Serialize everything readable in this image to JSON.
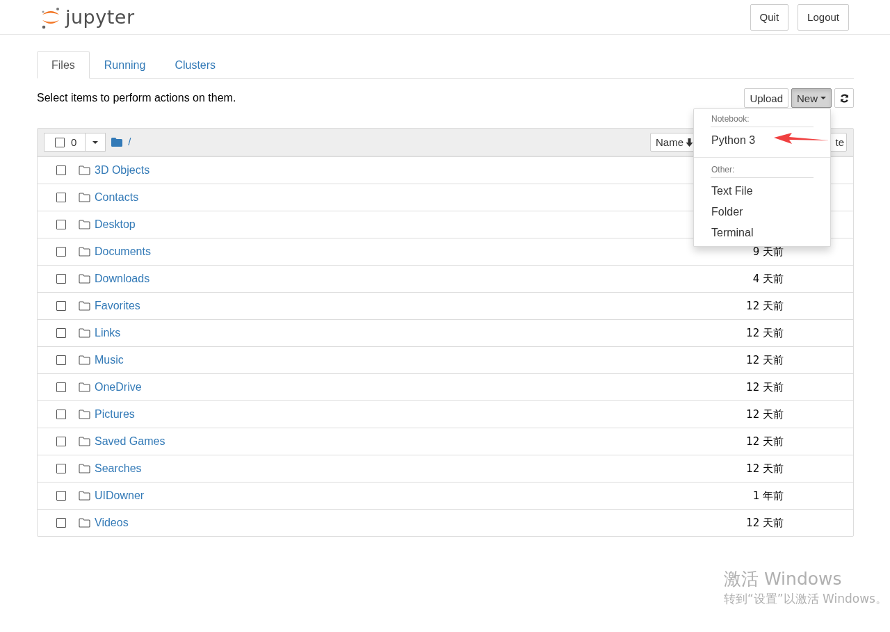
{
  "header": {
    "logo_text": "jupyter",
    "buttons": [
      "Quit",
      "Logout"
    ]
  },
  "tabs": [
    {
      "label": "Files",
      "selected": true
    },
    {
      "label": "Running",
      "selected": false
    },
    {
      "label": "Clusters",
      "selected": false
    }
  ],
  "hint": "Select items to perform actions on them.",
  "toolbar": {
    "upload": "Upload",
    "new": "New",
    "new_open": true
  },
  "list_header": {
    "count": "0",
    "checked": false,
    "path": "/",
    "sort_buttons": [
      "Name",
      "te"
    ]
  },
  "new_menu": {
    "sections": [
      {
        "heading": "Notebook:",
        "items": [
          "Python 3"
        ]
      },
      {
        "heading": "Other:",
        "items": [
          "Text File",
          "Folder",
          "Terminal"
        ]
      }
    ]
  },
  "rows": [
    {
      "name": "3D Objects",
      "checked": false
    },
    {
      "name": "Contacts",
      "checked": false
    },
    {
      "name": "Desktop",
      "checked": false
    },
    {
      "name": "Documents",
      "modified": "9 天前",
      "checked": false
    },
    {
      "name": "Downloads",
      "modified": "4 天前",
      "checked": false
    },
    {
      "name": "Favorites",
      "modified": "12 天前",
      "checked": false
    },
    {
      "name": "Links",
      "modified": "12 天前",
      "checked": false
    },
    {
      "name": "Music",
      "modified": "12 天前",
      "checked": false
    },
    {
      "name": "OneDrive",
      "modified": "12 天前",
      "checked": false
    },
    {
      "name": "Pictures",
      "modified": "12 天前",
      "checked": false
    },
    {
      "name": "Saved Games",
      "modified": "12 天前",
      "checked": false
    },
    {
      "name": "Searches",
      "modified": "12 天前",
      "checked": false
    },
    {
      "name": "UIDowner",
      "modified": "1 年前",
      "checked": false
    },
    {
      "name": "Videos",
      "modified": "12 天前",
      "checked": false
    }
  ],
  "activation_notice": {
    "title": "激活 Windows",
    "text": "转到“设置”以激活 Windows。"
  }
}
